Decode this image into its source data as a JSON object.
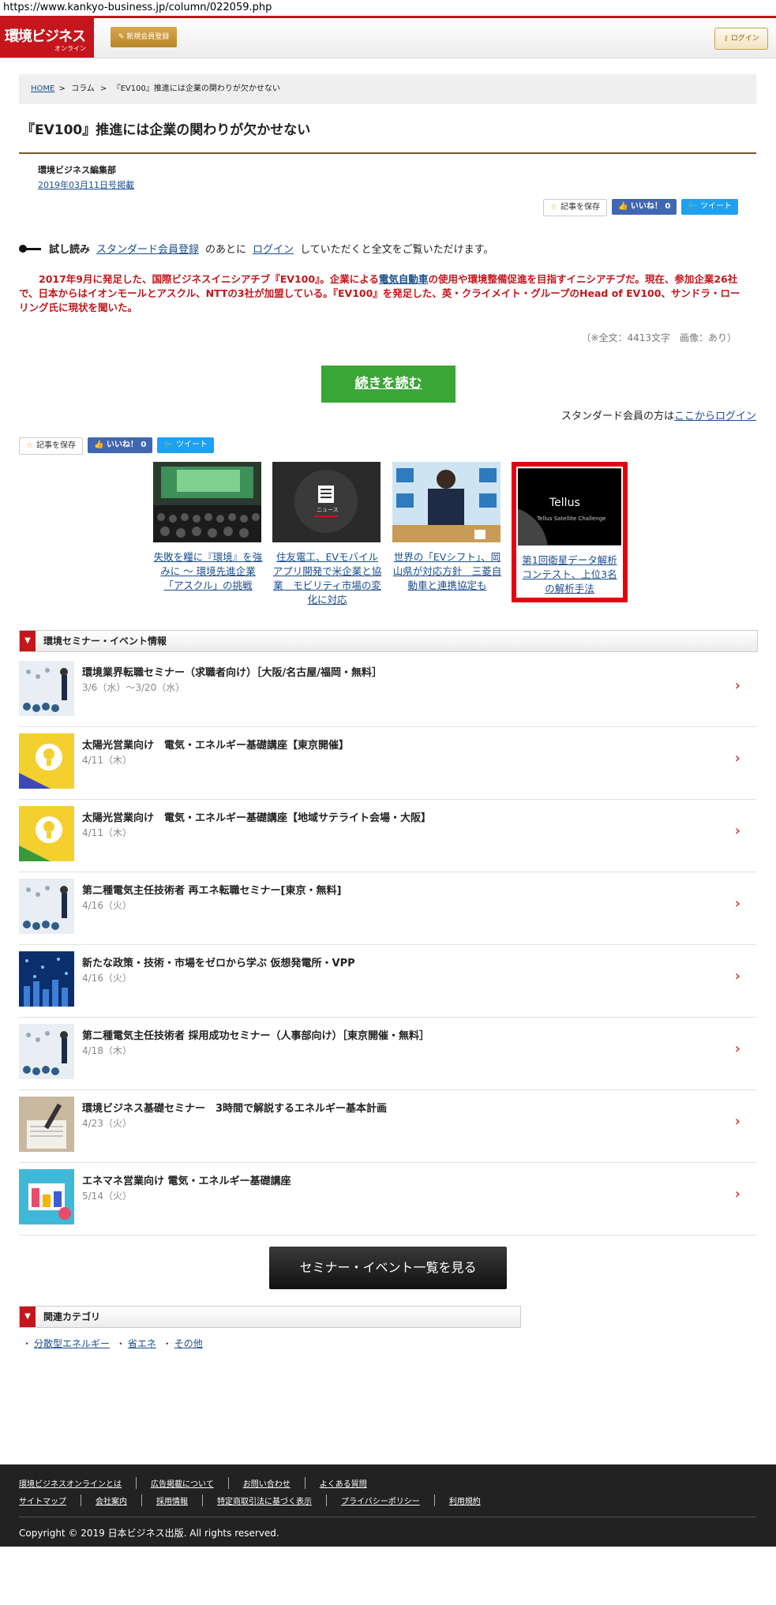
{
  "url": "https://www.kankyo-business.jp/column/022059.php",
  "header": {
    "logo_main": "環境ビジネス",
    "logo_sub": "オンライン",
    "register_label": "新規会員登録",
    "login_label": "ログイン",
    "brand_color": "#c4161c"
  },
  "breadcrumb": [
    "HOME",
    "コラム",
    "『EV100』推進には企業の関わりが欠かせない"
  ],
  "article": {
    "title": "『EV100』推進には企業の関わりが欠かせない",
    "author": "環境ビジネス編集部",
    "date": "2019年03月11日号掲載",
    "trial_label": "試し読み",
    "trial_link1": "スタンダード会員登録",
    "trial_mid": "のあとに",
    "trial_link2": "ログイン",
    "trial_tail": "していただくと全文をご覧いただけます。",
    "lead_1": "2017年9月に発足した、国際ビジネスイニシアチブ『EV100』。企業による",
    "lead_link": "電気自動車",
    "lead_2": "の使用や環境整備促進を目指すイニシアチブだ。現在、参加企業26社で、日本からはイオンモールとアスクル、NTTの3社が加盟している。『EV100』を発足した、英・クライメイト・グループのHead of EV100、サンドラ・ローリング氏に現状を聞いた。",
    "meta": "（※全文：4413文字　画像：あり）",
    "read_more": "続きを読む",
    "std_text": "スタンダード会員の方は",
    "std_link": "ここからログイン"
  },
  "social": {
    "save": "記事を保存",
    "like": "いいね！ 0",
    "tweet": "ツイート"
  },
  "related": [
    {
      "caption": "失敗を糧に『環境』を強みに ～ 環境先進企業「アスクル」の挑戦"
    },
    {
      "caption": "住友電工、EVモバイルアプリ開発で米企業と協業　モビリティ市場の変化に対応",
      "thumb_label": "ニュース"
    },
    {
      "caption": "世界の「EVシフト」、岡山県が対応方針　三菱自動車と連携協定も"
    },
    {
      "caption": "第1回衛星データ解析コンテスト、上位3名の解析手法",
      "thumb_label": "Tellus",
      "thumb_sub": "Tellus Satellite Challenge"
    }
  ],
  "seminar": {
    "heading": "環境セミナー・イベント情報",
    "items": [
      {
        "title": "環境業界転職セミナー（求職者向け）［大阪/名古屋/福岡・無料］",
        "date": "3/6（水）～3/20（水）"
      },
      {
        "title": "太陽光営業向け　電気・エネルギー基礎講座【東京開催】",
        "date": "4/11（木）"
      },
      {
        "title": "太陽光営業向け　電気・エネルギー基礎講座【地域サテライト会場・大阪】",
        "date": "4/11（木）"
      },
      {
        "title": "第二種電気主任技術者 再エネ転職セミナー[東京・無料]",
        "date": "4/16（火）"
      },
      {
        "title": "新たな政策・技術・市場をゼロから学ぶ 仮想発電所・VPP",
        "date": "4/16（火）"
      },
      {
        "title": "第二種電気主任技術者 採用成功セミナー（人事部向け）［東京開催・無料］",
        "date": "4/18（木）"
      },
      {
        "title": "環境ビジネス基礎セミナー　3時間で解説するエネルギー基本計画",
        "date": "4/23（火）"
      },
      {
        "title": "エネマネ営業向け 電気・エネルギー基礎講座",
        "date": "5/14（火）"
      }
    ],
    "all_button": "セミナー・イベント一覧を見る"
  },
  "categories": {
    "heading": "関連カテゴリ",
    "items": [
      "分散型エネルギー",
      "省エネ",
      "その他"
    ]
  },
  "footer": {
    "row1": [
      "環境ビジネスオンラインとは",
      "広告掲載について",
      "お問い合わせ",
      "よくある質問"
    ],
    "row2": [
      "サイトマップ",
      "会社案内",
      "採用情報",
      "特定商取引法に基づく表示",
      "プライバシーポリシー",
      "利用規約"
    ],
    "copyright": "Copyright © 2019 日本ビジネス出版. All rights reserved."
  }
}
